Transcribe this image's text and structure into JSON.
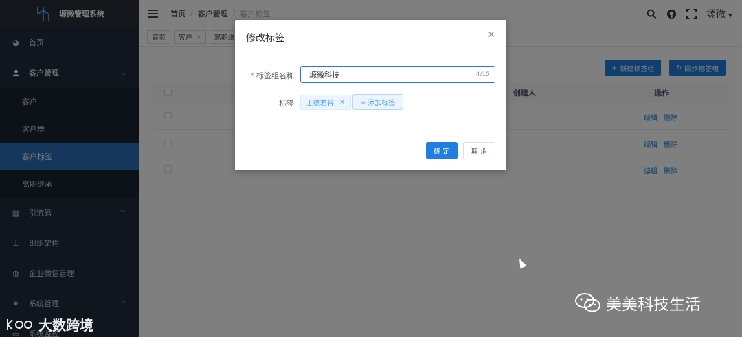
{
  "sidebar": {
    "title": "塬微管理系统",
    "items": [
      {
        "label": "首页",
        "icon": "dashboard-icon"
      },
      {
        "label": "客户管理",
        "icon": "user-icon"
      },
      {
        "label": "引流码",
        "icon": "qrcode-icon"
      },
      {
        "label": "组织架构",
        "icon": "org-tree-icon"
      },
      {
        "label": "企业微信管理",
        "icon": "wechat-icon"
      },
      {
        "label": "系统管理",
        "icon": "gear-icon"
      },
      {
        "label": "系统监控",
        "icon": "monitor-icon"
      }
    ],
    "sub_items": [
      "客户",
      "客户群",
      "客户标签",
      "离职继承"
    ]
  },
  "header": {
    "breadcrumb": [
      "首页",
      "客户管理",
      "客户标签"
    ],
    "user_name": "塬微"
  },
  "tags_view": [
    "首页",
    "客户",
    "离职继承"
  ],
  "toolbar": {
    "new_group_label": "新建标签组",
    "sync_label": "同步标签组"
  },
  "table": {
    "headers": {
      "creator": "创建人",
      "actions": "操作"
    },
    "rows": [
      {
        "edit": "编辑",
        "delete": "删除"
      },
      {
        "edit": "编辑",
        "delete": "删除"
      },
      {
        "edit": "编辑",
        "delete": "删除"
      }
    ]
  },
  "dialog": {
    "title": "修改标签",
    "group_name_label": "标签组名称",
    "group_name_value": "塬微科技",
    "group_name_count": "4/15",
    "tags_label": "标签",
    "tag_items": [
      "上德若谷"
    ],
    "add_tag_label": "+ 添加标签",
    "ok_label": "确 定",
    "cancel_label": "取 消"
  },
  "watermark": {
    "left": "大数跨境",
    "right": "美美科技生活"
  },
  "colors": {
    "primary": "#1f7ee0",
    "sidebar_bg": "#1f2d3d",
    "active_item": "#2d6fb8"
  }
}
